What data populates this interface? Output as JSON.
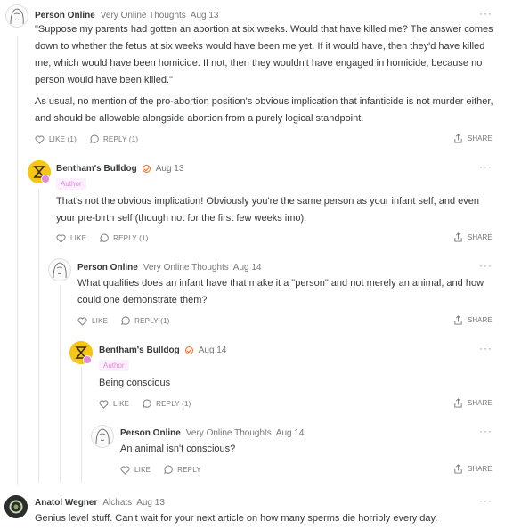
{
  "ui": {
    "more": "···",
    "author_tag": "Author",
    "share": "SHARE"
  },
  "comments": [
    {
      "name": "Person Online",
      "publication": "Very Online Thoughts",
      "date": "Aug 13",
      "paragraphs": [
        "\"Suppose my parents had gotten an abortion at six weeks. Would that have killed me? The answer comes down to whether the fetus at six weeks would have been me yet. If it would have, then they'd have killed me, which would have been homicide. If not, then they wouldn't have engaged in homicide, because no person would have been killed.\"",
        "As usual, no mention of the pro-abortion position's obvious implication that infanticide is not murder either, and should be allowable alongside abortion from a purely logical standpoint."
      ],
      "like": "LIKE (1)",
      "reply": "REPLY (1)"
    },
    {
      "name": "Bentham's Bulldog",
      "date": "Aug 13",
      "paragraphs": [
        "That's not the obvious implication! Obviously you're the same person as your infant self, and even your pre-birth self (though not for the first few weeks imo)."
      ],
      "like": "LIKE",
      "reply": "REPLY (1)"
    },
    {
      "name": "Person Online",
      "publication": "Very Online Thoughts",
      "date": "Aug 14",
      "paragraphs": [
        "What qualities does an infant have that make it a \"person\" and not merely an animal, and how could one demonstrate them?"
      ],
      "like": "LIKE",
      "reply": "REPLY (1)"
    },
    {
      "name": "Bentham's Bulldog",
      "date": "Aug 14",
      "paragraphs": [
        "Being conscious"
      ],
      "like": "LIKE",
      "reply": "REPLY (1)"
    },
    {
      "name": "Person Online",
      "publication": "Very Online Thoughts",
      "date": "Aug 14",
      "paragraphs": [
        "An animal isn't conscious?"
      ],
      "like": "LIKE",
      "reply": "REPLY"
    },
    {
      "name": "Anatol Wegner",
      "publication": "Alchats",
      "date": "Aug 13",
      "paragraphs": [
        "Genius level stuff. Can't wait for your next article on how many sperms die horribly every day."
      ]
    }
  ]
}
